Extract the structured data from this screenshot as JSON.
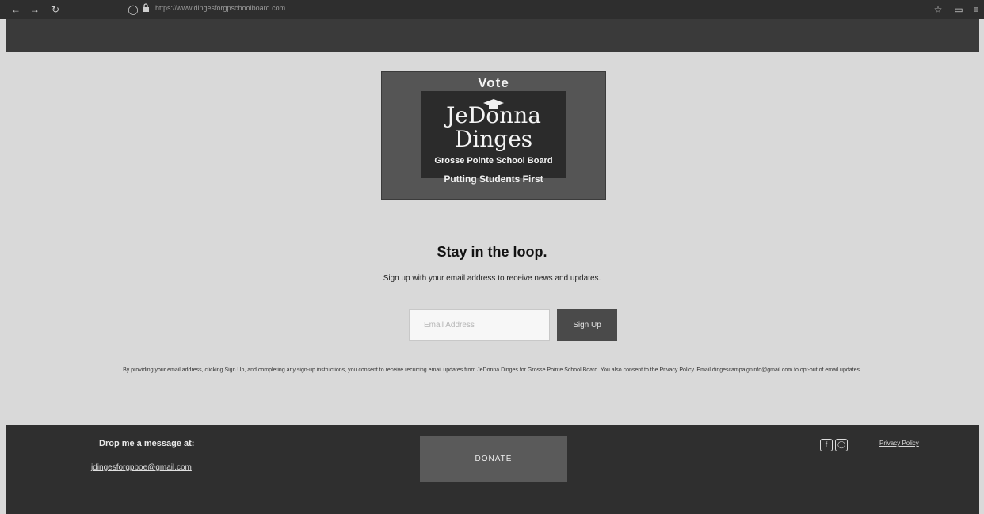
{
  "browser": {
    "url": "https://www.dingesforgpschoolboard.com",
    "icons": {
      "back": "arrow-left-icon",
      "forward": "arrow-right-icon",
      "reload": "reload-icon",
      "shield": "shield-icon",
      "lock": "lock-icon",
      "star": "star-icon",
      "extensions": "extensions-icon",
      "menu": "hamburger-menu-icon"
    }
  },
  "logo": {
    "vote": "Vote",
    "name_line1": "JeDonna",
    "name_line2": "Dinges",
    "board": "Grosse Pointe School Board",
    "tagline": "Putting Students First",
    "icon": "graduation-cap-icon"
  },
  "signup": {
    "title": "Stay in the loop.",
    "subtitle": "Sign up with your email address to receive news and updates.",
    "email_placeholder": "Email Address",
    "button_label": "Sign Up",
    "consent": "By providing your email address, clicking Sign Up, and completing any sign-up instructions, you consent to receive recurring email updates from JeDonna Dinges for Grosse Pointe School Board. You also consent to the Privacy Policy. Email dingescampaigninfo@gmail.com to opt-out of email updates."
  },
  "footer": {
    "heading": "Drop me a message at:",
    "email": "jdingesforgpboe@gmail.com",
    "donate_label": "DONATE",
    "privacy_label": "Privacy Policy",
    "social": [
      "facebook-icon",
      "instagram-icon"
    ]
  },
  "colors": {
    "page_bg": "#d9d9d9",
    "header_bg": "#3a3a3a",
    "footer_bg": "#2f2f2f",
    "button_bg": "#4a4a4a"
  }
}
